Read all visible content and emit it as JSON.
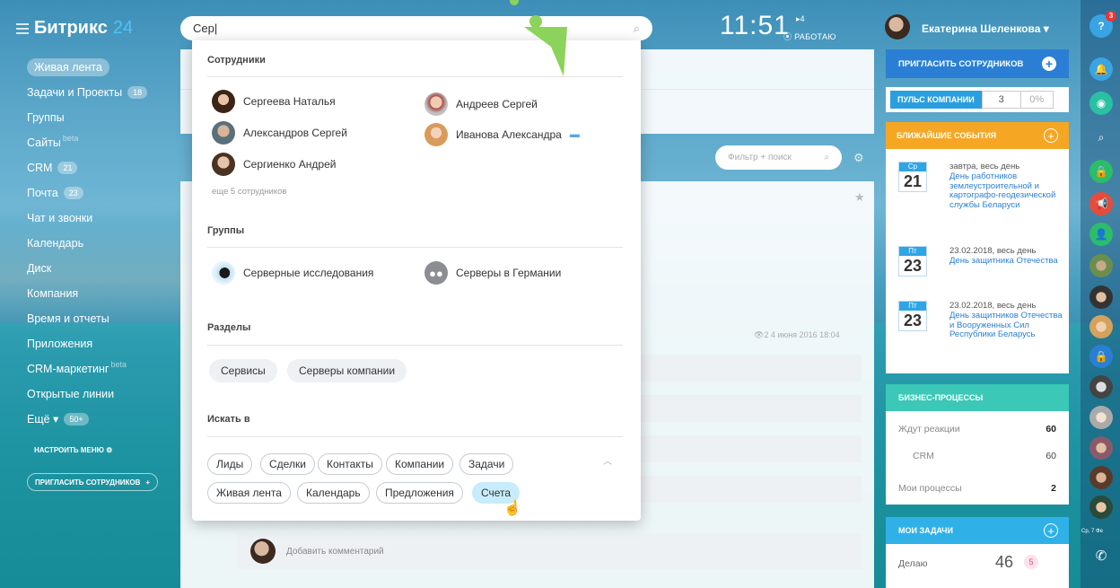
{
  "app": {
    "logo_text": "Битрикс",
    "logo_num": "24"
  },
  "search": {
    "value": "Сер|"
  },
  "clock": {
    "time": "11:51",
    "flag": "▸4",
    "status": "⦿ РАБОТАЮ"
  },
  "user": {
    "name": "Екатерина Шеленкова ▾"
  },
  "leftmenu": [
    {
      "label": "Живая лента",
      "active": true
    },
    {
      "label": "Задачи и Проекты",
      "count": "18"
    },
    {
      "label": "Группы"
    },
    {
      "label": "Сайты",
      "beta": "beta"
    },
    {
      "label": "CRM",
      "count": "21"
    },
    {
      "label": "Почта",
      "count": "23"
    },
    {
      "label": "Чат и звонки"
    },
    {
      "label": "Календарь"
    },
    {
      "label": "Диск"
    },
    {
      "label": "Компания"
    },
    {
      "label": "Время и отчеты"
    },
    {
      "label": "Приложения"
    },
    {
      "label": "CRM-маркетинг",
      "beta": "beta"
    },
    {
      "label": "Открытые линии"
    },
    {
      "label": "Ещё ▾",
      "count": "50+"
    }
  ],
  "leftmenu_settings": "НАСТРОИТЬ МЕНЮ  ⚙",
  "leftmenu_invite": "ПРИГЛАСИТЬ СОТРУДНИКОВ",
  "feed": {
    "filter_placeholder": "Фильтр + поиск",
    "meta": "👁2   4 июня 2016 18:04",
    "comment_placeholder": "Добавить комментарий"
  },
  "right": {
    "invite": "ПРИГЛАСИТЬ СОТРУДНИКОВ",
    "pulse_label": "ПУЛЬС КОМПАНИИ",
    "pulse_value": "3",
    "pulse_pct": "0%",
    "events_title": "БЛИЖАЙШИЕ СОБЫТИЯ",
    "events": [
      {
        "dow": "Ср",
        "day": "21",
        "when": "завтра, весь день",
        "title": "День работников землеустроительной и картографо-геодезической службы Беларуси"
      },
      {
        "dow": "Пт",
        "day": "23",
        "when": "23.02.2018, весь день",
        "title": "День защитника Отечества"
      },
      {
        "dow": "Пт",
        "day": "23",
        "when": "23.02.2018, весь день",
        "title": "День защитников Отечества и Вооруженных Сил Республики Беларусь"
      }
    ],
    "bp_title": "БИЗНЕС-ПРОЦЕССЫ",
    "bp_rows": [
      {
        "label": "Ждут реакции",
        "value": "60"
      },
      {
        "label": "CRM",
        "value": "60"
      },
      {
        "label": "Мои процессы",
        "value": "2"
      }
    ],
    "tasks_title": "МОИ ЗАДАЧИ",
    "tasks_label": "Делаю",
    "tasks_value": "46",
    "tasks_badge": "5"
  },
  "rbar": {
    "help_badge": "3",
    "date": "Ср, 7 Фе"
  },
  "dropdown": {
    "employees_title": "Сотрудники",
    "employees": [
      {
        "name": "Сергеева Наталья"
      },
      {
        "name": "Андреев Сергей"
      },
      {
        "name": "Александров Сергей"
      },
      {
        "name": "Иванова Александра"
      },
      {
        "name": "Сергиенко Андрей"
      }
    ],
    "more_employees": "еще 5 сотрудников",
    "groups_title": "Группы",
    "groups": [
      {
        "name": "Серверные исследования"
      },
      {
        "name": "Серверы в Германии"
      }
    ],
    "sections_title": "Разделы",
    "sections": [
      "Сервисы",
      "Серверы компании"
    ],
    "search_in_title": "Искать в",
    "search_in": [
      "Лиды",
      "Сделки",
      "Контакты",
      "Компании",
      "Задачи",
      "Живая лента",
      "Календарь",
      "Предложения",
      "Счета"
    ]
  }
}
